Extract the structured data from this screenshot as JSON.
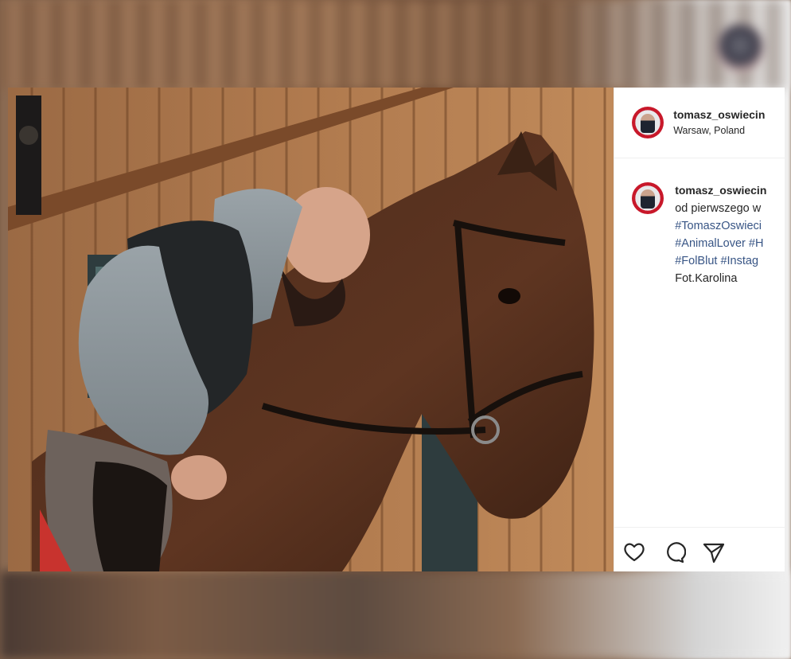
{
  "post": {
    "username": "tomasz_oswiecin",
    "location": "Warsaw, Poland",
    "caption": {
      "username": "tomasz_oswiecin",
      "lines": [
        {
          "text": "od pierwszego w",
          "kind": "text"
        },
        {
          "text": "#TomaszOswieci",
          "kind": "hashtag"
        },
        {
          "text": "#AnimalLover #H",
          "kind": "hashtag"
        },
        {
          "text": "#FolBlut #Instag",
          "kind": "hashtag"
        },
        {
          "text": "Fot.Karolina",
          "kind": "text"
        }
      ]
    },
    "actions": {
      "like_icon": "heart-icon",
      "comment_icon": "comment-icon",
      "share_icon": "paper-plane-icon"
    },
    "colors": {
      "hashtag": "#385585",
      "text": "#262626",
      "avatar_ring": "#c8182a"
    }
  }
}
